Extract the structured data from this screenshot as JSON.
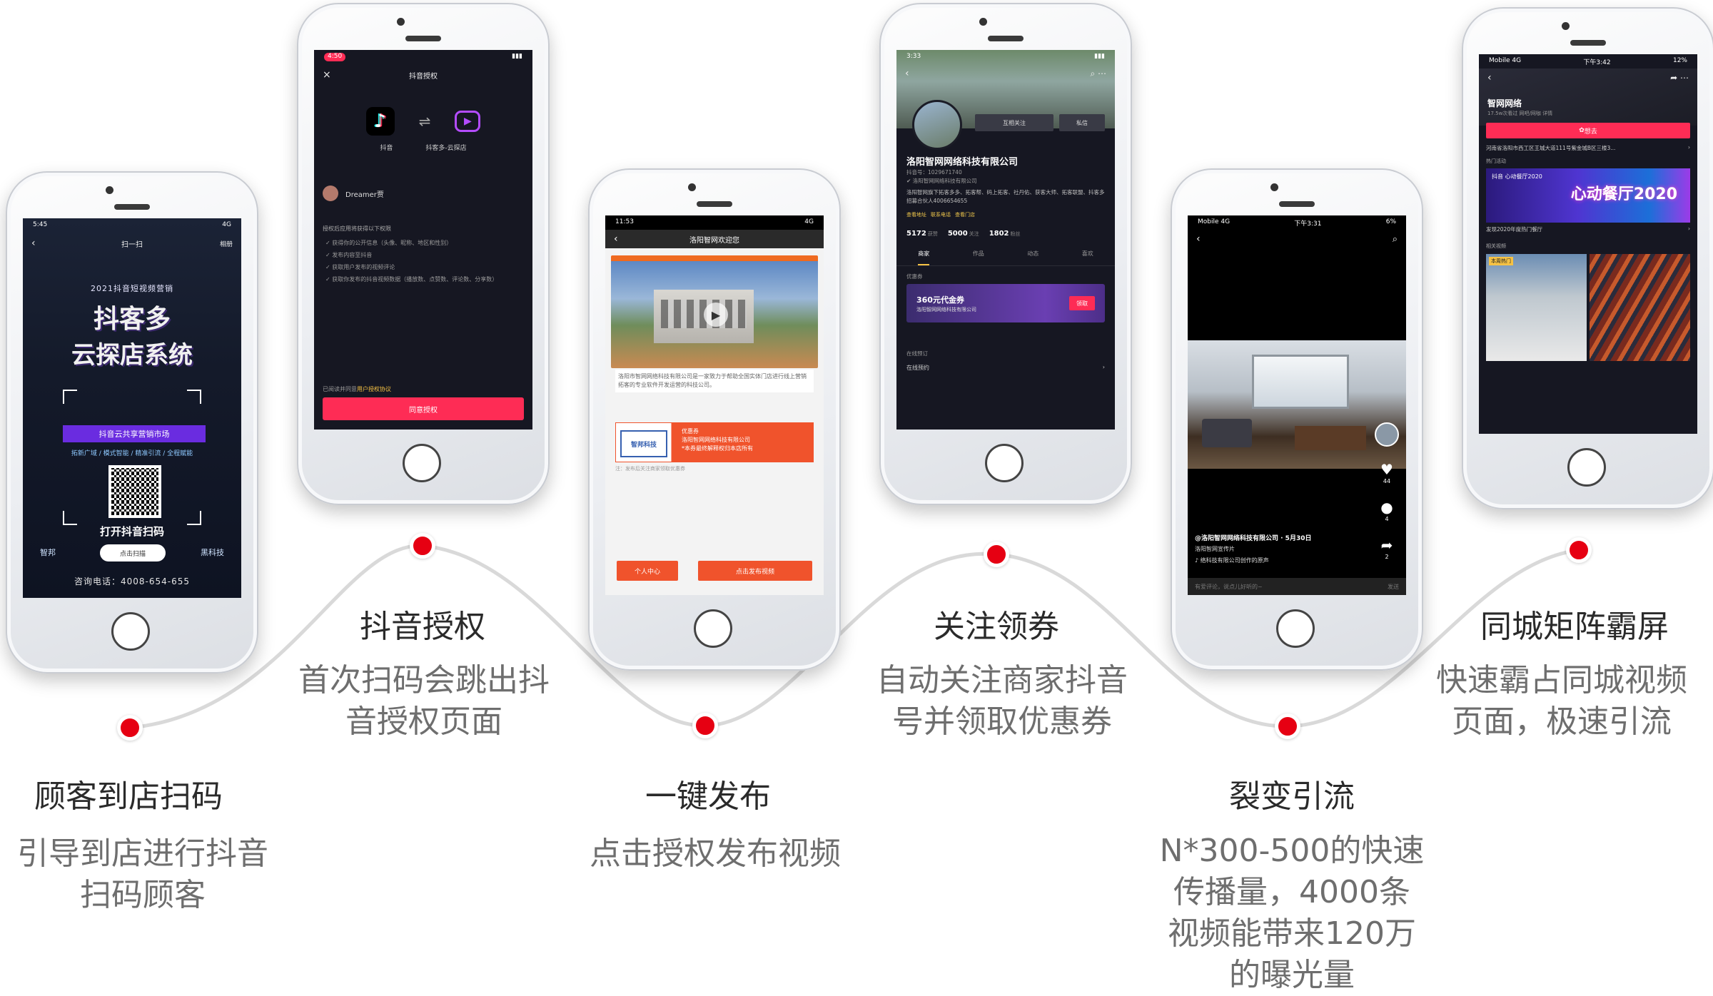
{
  "steps": [
    {
      "title": "顾客到店扫码",
      "desc_lines": [
        "引导到店进行抖音",
        "扫码顾客"
      ],
      "screen": {
        "time": "5:45",
        "signal": "4G",
        "nav_title": "扫一扫",
        "nav_right": "相册",
        "poster_sub": "2021抖音短视频营销",
        "poster_line1": "抖客多",
        "poster_line2": "云探店系统",
        "poster_tag": "抖音云共享营销市场",
        "poster_features": "拓新广域 / 模式智能 / 精准引流 / 全程赋能",
        "poster_bottom": "打开抖音扫码",
        "scan_btn": "点击扫描",
        "brand_left": "智邦",
        "brand_right": "黑科技",
        "phone_line": "咨询电话：4008-654-655"
      }
    },
    {
      "title": "抖音授权",
      "desc_lines": [
        "首次扫码会跳出抖",
        "音授权页面"
      ],
      "screen": {
        "time": "4:50",
        "nav_title": "抖音授权",
        "left_app": "抖音",
        "right_app": "抖客多-云探店",
        "user": "Dreamer贾",
        "perm_intro": "授权后应用将获得以下权限",
        "perms": [
          "获得你的公开信息（头像、昵称、地区和性别）",
          "发布内容至抖音",
          "获取用户发布的视频评论",
          "获取你发布的抖音视频数据（播放数、点赞数、评论数、分享数）"
        ],
        "agree_prefix": "已阅读并同意",
        "agree_link": "用户授权协议",
        "button": "同意授权"
      }
    },
    {
      "title": "一键发布",
      "desc_lines": [
        "点击授权发布视频"
      ],
      "screen": {
        "time": "11:53",
        "signal": "4G",
        "nav_title": "洛阳智网欢迎您",
        "intro": "洛阳市智网网络科技有限公司是一家致力于帮助全国实体门店进行线上营销拓客的专业软件开发运营的科技公司。",
        "coupon_logo": "智邦科技",
        "coupon_label": "优惠券",
        "coupon_shop": "洛阳智网网络科技有限公司",
        "coupon_rule": "*本券最终解释权归本店所有",
        "note": "注：发布后关注商家领取优惠券",
        "btn_left": "个人中心",
        "btn_right": "点击发布视频"
      }
    },
    {
      "title": "关注领券",
      "desc_lines": [
        "自动关注商家抖音",
        "号并领取优惠券"
      ],
      "screen": {
        "time": "3:33",
        "btn_follow": "互相关注",
        "btn_msg": "私信",
        "name": "洛阳智网网络科技有限公司",
        "douyin_id": "抖音号：1029671740",
        "verified": "洛阳智网网络科技有限公司",
        "desc": "洛阳智网旗下拓客多多、拓客帮、码上拓客、社丹佑、获客大师、拓客联盟、抖客多招募合伙人4006654655",
        "tags": [
          "查看地址",
          "联系电话",
          "查看门店"
        ],
        "stats": [
          {
            "num": "5172",
            "label": "获赞"
          },
          {
            "num": "5000",
            "label": "关注"
          },
          {
            "num": "1802",
            "label": "粉丝"
          }
        ],
        "tabs": [
          "商家",
          "作品",
          "动态",
          "喜欢"
        ],
        "section_coupon": "优惠券",
        "coupon_amount": "360元代金券",
        "coupon_shop": "洛阳智网网络科技有限公司",
        "coupon_btn": "领取",
        "section_online": "在线预订",
        "online_row": "在线预约"
      }
    },
    {
      "title": "裂变引流",
      "desc_lines": [
        "N*300-500的快速",
        "传播量，4000条",
        "视频能带来120万",
        "的曝光量"
      ],
      "screen": {
        "carrier": "Mobile 4G",
        "time": "下午3:31",
        "battery": "6%",
        "author": "@洛阳智网网络科技有限公司 · 5月30日",
        "caption": "洛阳智网宣传片",
        "music": "络科技有限公司创作的原声",
        "likes": "44",
        "comments": "4",
        "shares": "2",
        "comment_placeholder": "有爱评论，说点儿好听的~",
        "send": "发送"
      }
    },
    {
      "title": "同城矩阵霸屏",
      "desc_lines": [
        "快速霸占同城视频",
        "页面，极速引流"
      ],
      "screen": {
        "carrier": "Mobile 4G",
        "time": "下午3:42",
        "battery": "12%",
        "shop_name": "智网网络",
        "shop_meta": "17.5w次看过  网吧/网咖  详情",
        "follow": "想去",
        "address": "河南省洛阳市西工区王城大道111号紫金城B区三楼3...",
        "section_event": "热门活动",
        "event_title": "心动餐厅2020",
        "event_tag": "抖音 心动餐厅2020",
        "event_caption": "发现2020年度热门餐厅",
        "section_related": "相关视频",
        "thumb_label": "本周热门"
      }
    }
  ],
  "colors": {
    "dot": "#e60012",
    "curve": "#d9d9d9",
    "title_text": "#2a2a2a",
    "desc_text": "#6e6e6e",
    "douyin_pink": "#fe2c55",
    "publish_orange": "#f0532c"
  }
}
